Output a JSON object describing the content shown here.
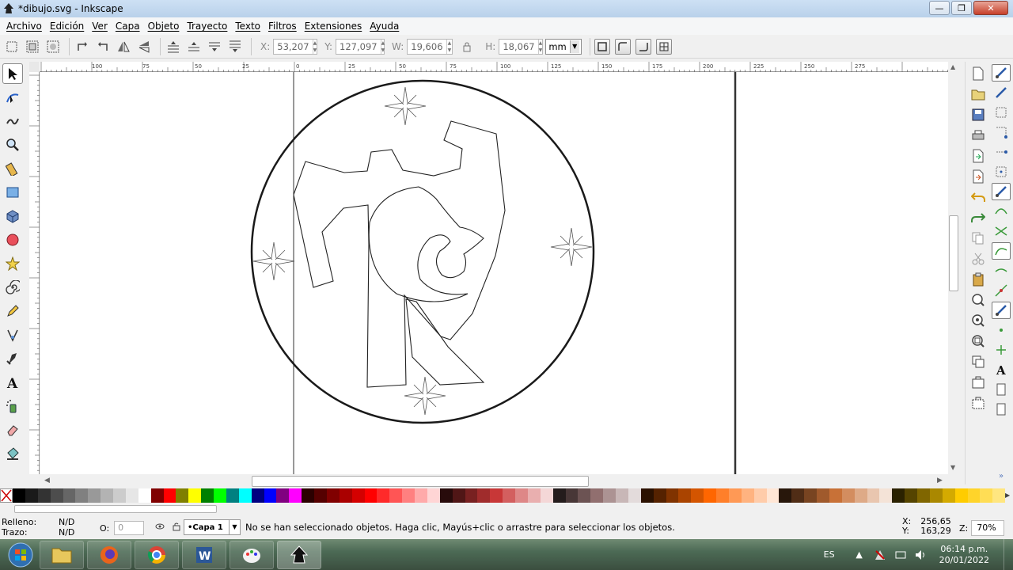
{
  "window": {
    "title": "*dibujo.svg - Inkscape",
    "minimize_glyph": "—",
    "maximize_glyph": "❐",
    "close_glyph": "✕"
  },
  "menu": [
    "Archivo",
    "Edición",
    "Ver",
    "Capa",
    "Objeto",
    "Trayecto",
    "Texto",
    "Filtros",
    "Extensiones",
    "Ayuda"
  ],
  "toolbar": {
    "x": {
      "label": "X:",
      "value": "53,207"
    },
    "y": {
      "label": "Y:",
      "value": "127,097"
    },
    "w": {
      "label": "W:",
      "value": "19,606"
    },
    "h": {
      "label": "H:",
      "value": "18,067"
    },
    "unit": "mm"
  },
  "ruler": {
    "labels": [
      "100",
      "75",
      "50",
      "25",
      "0",
      "25",
      "50",
      "75",
      "100",
      "125",
      "150",
      "175",
      "200",
      "225",
      "250",
      "275"
    ]
  },
  "left_tools": [
    "selector-tool-icon",
    "node-tool-icon",
    "tweak-tool-icon",
    "zoom-tool-icon",
    "measure-tool-icon",
    "rect-tool-icon",
    "3dbox-tool-icon",
    "ellipse-tool-icon",
    "star-tool-icon",
    "spiral-tool-icon",
    "pencil-tool-icon",
    "pen-tool-icon",
    "calligraphy-tool-icon",
    "text-tool-icon",
    "spray-tool-icon",
    "eraser-tool-icon",
    "paint-bucket-tool-icon"
  ],
  "palette_colors": [
    "#000000",
    "#1a1a1a",
    "#333333",
    "#4d4d4d",
    "#666666",
    "#808080",
    "#999999",
    "#b3b3b3",
    "#cccccc",
    "#e6e6e6",
    "#ffffff",
    "#800000",
    "#ff0000",
    "#808000",
    "#ffff00",
    "#008000",
    "#00ff00",
    "#008080",
    "#00ffff",
    "#000080",
    "#0000ff",
    "#800080",
    "#ff00ff",
    "#2b0000",
    "#550000",
    "#800000",
    "#aa0000",
    "#d40000",
    "#ff0000",
    "#ff2a2a",
    "#ff5555",
    "#ff8080",
    "#ffaaaa",
    "#ffd5d5",
    "#280b0b",
    "#501616",
    "#782121",
    "#a02c2c",
    "#c83737",
    "#d35f5f",
    "#de8787",
    "#e9afaf",
    "#f4d7d7",
    "#241c1c",
    "#483737",
    "#6c5353",
    "#916f6f",
    "#ac9393",
    "#c8b7b7",
    "#e3dbdb",
    "#2b1100",
    "#552200",
    "#803300",
    "#aa4400",
    "#d45500",
    "#ff6600",
    "#ff7f2a",
    "#ff9955",
    "#ffb380",
    "#ffccaa",
    "#ffe6d5",
    "#28170b",
    "#502d16",
    "#784421",
    "#a05a2c",
    "#c87137",
    "#d38d5f",
    "#deaa87",
    "#e9c6af",
    "#f4e3d7",
    "#2b2200",
    "#554400",
    "#806600",
    "#aa8800",
    "#d4aa00",
    "#ffcc00",
    "#ffd42a",
    "#ffdd55",
    "#ffe680"
  ],
  "status": {
    "fill_label": "Relleno:",
    "fill_value": "N/D",
    "stroke_label": "Trazo:",
    "stroke_value": "N/D",
    "opacity_label": "O:",
    "opacity_value": "0",
    "layer": "•Capa 1",
    "message": "No se han seleccionado objetos. Haga clic, Mayús+clic o arrastre para seleccionar los objetos.",
    "cx_label": "X:",
    "cx": "256,65",
    "cy_label": "Y:",
    "cy": "163,29",
    "zoom_label": "Z:",
    "zoom": "70%"
  },
  "taskbar": {
    "apps": [
      "explorer-icon",
      "firefox-icon",
      "chrome-icon",
      "word-icon",
      "paint-icon",
      "inkscape-icon"
    ],
    "lang": "ES",
    "time": "06:14 p.m.",
    "date": "20/01/2022"
  }
}
